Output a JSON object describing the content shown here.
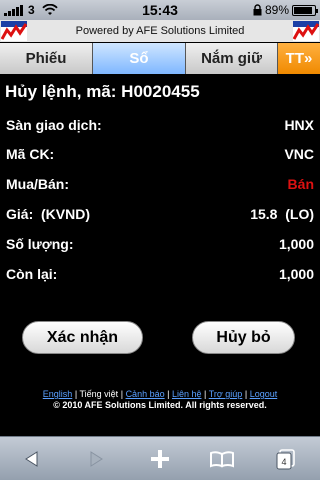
{
  "status_bar": {
    "carrier": "3",
    "time": "15:43",
    "battery_percent": "89%",
    "battery_level": 0.89
  },
  "header": {
    "powered_by": "Powered by AFE Solutions Limited"
  },
  "tabs": [
    {
      "label": "Phiếu",
      "selected": false
    },
    {
      "label": "Sổ",
      "selected": true
    },
    {
      "label": "Nắm giữ",
      "selected": false
    },
    {
      "label": "TT»",
      "selected": false
    }
  ],
  "order": {
    "title": "Hủy lệnh, mã: H0020455",
    "fields": [
      {
        "label": "Sàn giao dịch:",
        "value": "HNX"
      },
      {
        "label": "Mã CK:",
        "value": "VNC"
      },
      {
        "label": "Mua/Bán:",
        "value": "Bán"
      },
      {
        "label": "Giá:  (KVND)",
        "value": "15.8  (LO)"
      },
      {
        "label": "Số lượng:",
        "value": "1,000"
      },
      {
        "label": "Còn lại:",
        "value": "1,000"
      }
    ]
  },
  "actions": {
    "confirm": "Xác nhận",
    "cancel": "Hủy bỏ"
  },
  "footer": {
    "links": [
      "English",
      "Tiếng việt",
      "Cảnh báo",
      "Liên hệ",
      "Trợ giúp",
      "Logout"
    ],
    "separator": "|",
    "copyright": "© 2010 AFE Solutions Limited. All rights reserved."
  },
  "browser_toolbar": {
    "tab_count": "4"
  },
  "colors": {
    "sell": "#dd1111",
    "selected_tab": "#7fb7ff",
    "accent_tab": "#f08a00",
    "link": "#5aa0ff"
  }
}
